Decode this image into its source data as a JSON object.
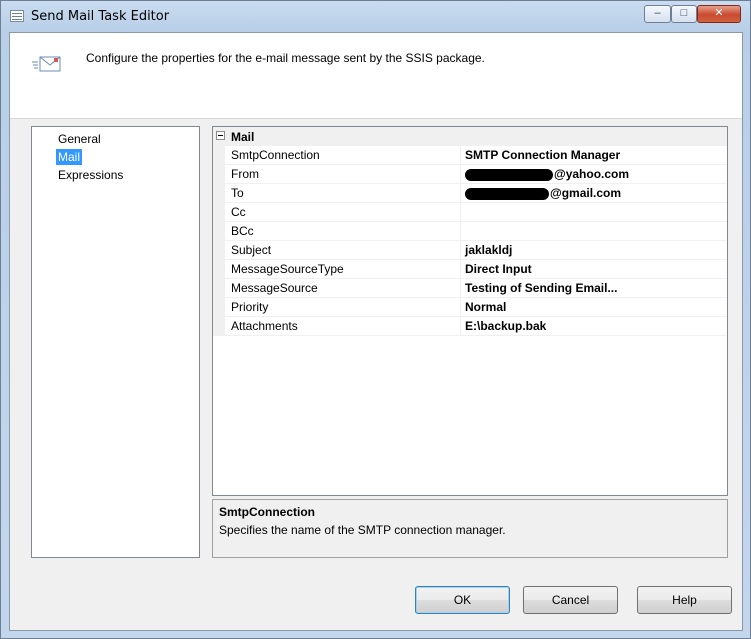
{
  "window": {
    "title": "Send Mail Task Editor",
    "minimize_glyph": "–",
    "maximize_glyph": "□",
    "close_glyph": "✕"
  },
  "header": {
    "description": "Configure the properties for the e-mail message sent by the SSIS package.",
    "icon": "mail-envelope-icon"
  },
  "nav": {
    "items": [
      {
        "label": "General",
        "selected": false
      },
      {
        "label": "Mail",
        "selected": true
      },
      {
        "label": "Expressions",
        "selected": false
      }
    ]
  },
  "grid": {
    "category": "Mail",
    "properties": [
      {
        "name": "SmtpConnection",
        "value": "SMTP Connection Manager"
      },
      {
        "name": "From",
        "value": "@yahoo.com",
        "redacted": true
      },
      {
        "name": "To",
        "value": "@gmail.com",
        "redacted": true
      },
      {
        "name": "Cc",
        "value": ""
      },
      {
        "name": "BCc",
        "value": ""
      },
      {
        "name": "Subject",
        "value": "jaklakldj"
      },
      {
        "name": "MessageSourceType",
        "value": "Direct Input"
      },
      {
        "name": "MessageSource",
        "value": "Testing of Sending Email..."
      },
      {
        "name": "Priority",
        "value": "Normal"
      },
      {
        "name": "Attachments",
        "value": "E:\\backup.bak"
      }
    ]
  },
  "description_panel": {
    "title": "SmtpConnection",
    "text": "Specifies the name of the SMTP connection manager."
  },
  "buttons": {
    "ok": "OK",
    "cancel": "Cancel",
    "help": "Help"
  },
  "colors": {
    "selection": "#3399ff",
    "title_gradient_top": "#c9dcf0",
    "close_button": "#c94a30"
  }
}
